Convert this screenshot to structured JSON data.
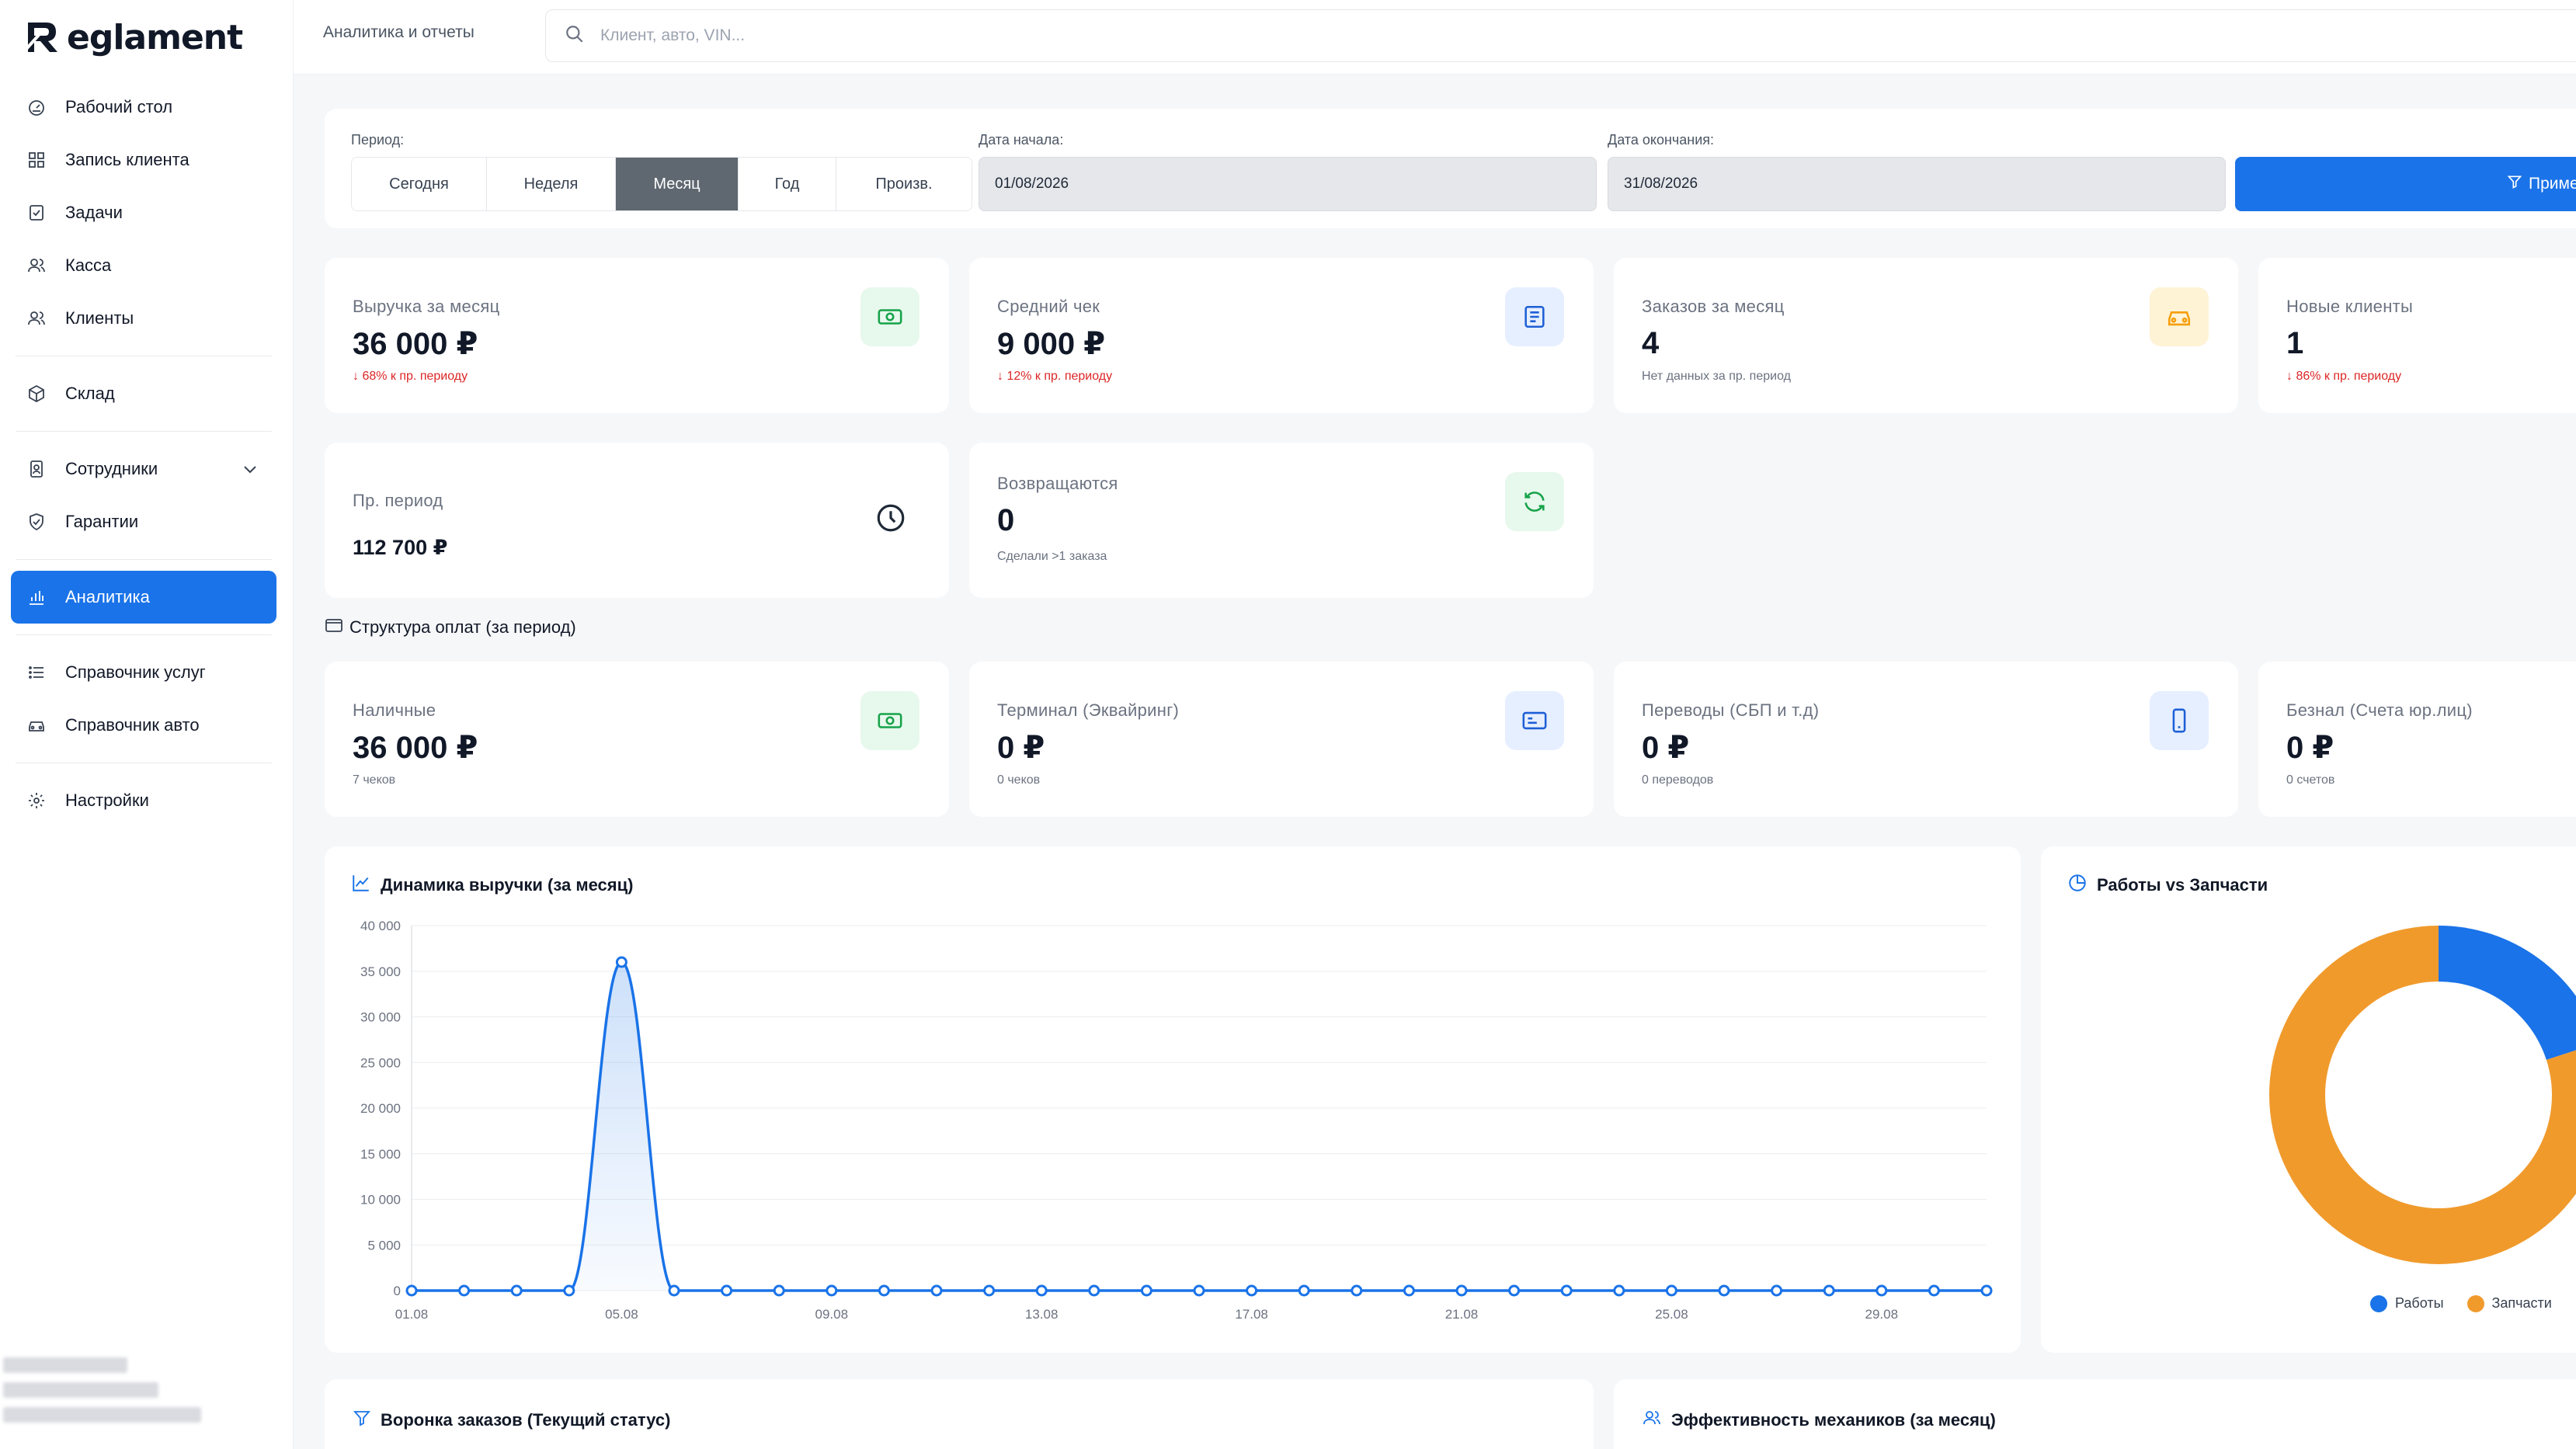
{
  "app": {
    "logo_text": "eglament"
  },
  "sidebar": {
    "items": [
      {
        "label": "Рабочий стол",
        "icon": "dashboard-gauge-icon"
      },
      {
        "label": "Запись клиента",
        "icon": "grid-icon"
      },
      {
        "label": "Задачи",
        "icon": "checkbox-icon"
      },
      {
        "label": "Касса",
        "icon": "users-icon"
      },
      {
        "label": "Клиенты",
        "icon": "users-icon"
      },
      {
        "label": "Склад",
        "icon": "box-icon"
      },
      {
        "label": "Сотрудники",
        "icon": "badge-icon"
      },
      {
        "label": "Гарантии",
        "icon": "shield-icon"
      },
      {
        "label": "Аналитика",
        "icon": "bar-chart-icon"
      },
      {
        "label": "Справочник услуг",
        "icon": "list-icon"
      },
      {
        "label": "Справочник авто",
        "icon": "car-icon"
      },
      {
        "label": "Настройки",
        "icon": "gear-icon"
      }
    ]
  },
  "header": {
    "title": "Аналитика и отчеты",
    "search_placeholder": "Клиент, авто, VIN..."
  },
  "filter": {
    "period_label": "Период:",
    "periods": [
      "Сегодня",
      "Неделя",
      "Месяц",
      "Год",
      "Произв."
    ],
    "active_period": "Месяц",
    "start_label": "Дата начала:",
    "start_value": "01/08/2026",
    "end_label": "Дата окончания:",
    "end_value": "31/08/2026",
    "apply_label": "Примени"
  },
  "kpis": {
    "revenue": {
      "label": "Выручка за месяц",
      "value": "36 000 ₽",
      "sub": "↓ 68% к пр. периоду"
    },
    "avg_check": {
      "label": "Средний чек",
      "value": "9 000 ₽",
      "sub": "↓ 12% к пр. периоду"
    },
    "orders": {
      "label": "Заказов за месяц",
      "value": "4",
      "sub": "Нет данных за пр. период"
    },
    "new_clients": {
      "label": "Новые клиенты",
      "value": "1",
      "sub": "↓ 86% к пр. периоду"
    },
    "prev_period": {
      "label": "Пр. период",
      "value": "112 700 ₽"
    },
    "returning": {
      "label": "Возвращаются",
      "value": "0",
      "sub": "Сделали >1 заказа"
    }
  },
  "payments": {
    "title": "Структура оплат (за период)",
    "cash": {
      "label": "Наличные",
      "value": "36 000 ₽",
      "sub": "7 чеков"
    },
    "terminal": {
      "label": "Терминал (Эквайринг)",
      "value": "0 ₽",
      "sub": "0 чеков"
    },
    "transfers": {
      "label": "Переводы (СБП и т.д)",
      "value": "0 ₽",
      "sub": "0 переводов"
    },
    "cashless": {
      "label": "Безнал (Счета юр.лиц)",
      "value": "0 ₽",
      "sub": "0 счетов"
    }
  },
  "bottom": {
    "funnel_title": "Воронка заказов (Текущий статус)",
    "mechanics_title": "Эффективность механиков (за месяц)"
  },
  "colors": {
    "accent": "#1a73e8",
    "orange": "#f09a2c",
    "red": "#dc2626"
  },
  "chart_data": [
    {
      "type": "area",
      "title": "Динамика выручки (за месяц)",
      "x": [
        "01.08",
        "02.08",
        "03.08",
        "04.08",
        "05.08",
        "06.08",
        "07.08",
        "08.08",
        "09.08",
        "10.08",
        "11.08",
        "12.08",
        "13.08",
        "14.08",
        "15.08",
        "16.08",
        "17.08",
        "18.08",
        "19.08",
        "20.08",
        "21.08",
        "22.08",
        "23.08",
        "24.08",
        "25.08",
        "26.08",
        "27.08",
        "28.08",
        "29.08",
        "30.08",
        "31.08"
      ],
      "x_tick_labels": [
        "01.08",
        "05.08",
        "09.08",
        "13.08",
        "17.08",
        "21.08",
        "25.08",
        "29.08"
      ],
      "y_tick_labels": [
        "0",
        "5 000",
        "10 000",
        "15 000",
        "20 000",
        "25 000",
        "30 000",
        "35 000",
        "40 000"
      ],
      "series": [
        {
          "values": [
            0,
            0,
            0,
            0,
            36000,
            0,
            0,
            0,
            0,
            0,
            0,
            0,
            0,
            0,
            0,
            0,
            0,
            0,
            0,
            0,
            0,
            0,
            0,
            0,
            0,
            0,
            0,
            0,
            0,
            0,
            0
          ]
        }
      ],
      "ylim": [
        0,
        40000
      ],
      "grid": true
    },
    {
      "type": "pie",
      "title": "Работы vs Запчасти",
      "categories": [
        "Работы",
        "Запчасти"
      ],
      "values": [
        20,
        80
      ],
      "colors": [
        "#1a73e8",
        "#f09a2c"
      ],
      "legend": "bottom"
    }
  ]
}
